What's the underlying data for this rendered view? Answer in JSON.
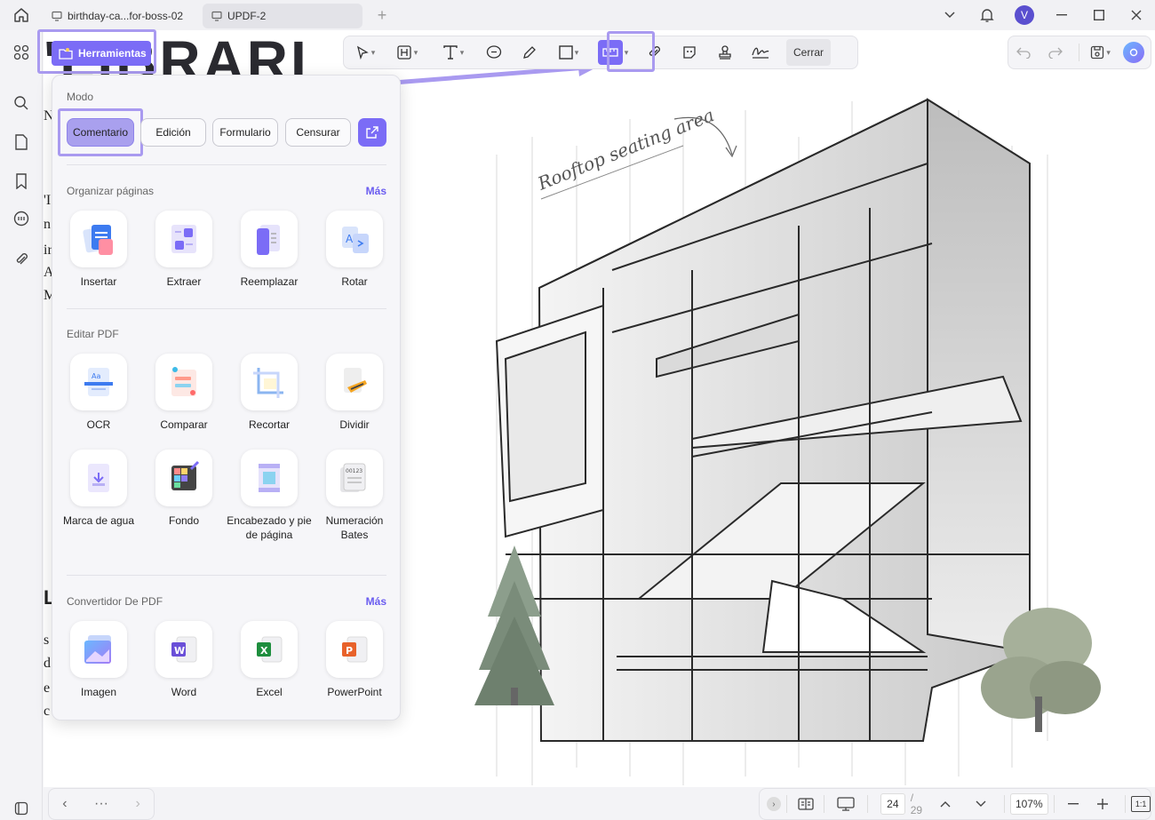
{
  "titlebar": {
    "tabs": [
      {
        "label": "birthday-ca...for-boss-02"
      },
      {
        "label": "UPDF-2"
      }
    ],
    "avatar_initial": "V"
  },
  "document": {
    "heading": "'LIBRARI",
    "snippets": [
      "Na",
      "'I",
      "n",
      "ir",
      "A",
      "M"
    ],
    "heading2": "L",
    "snippets2": [
      "s V",
      "d",
      "e",
      "c"
    ],
    "illustration_caption": "Rooftop seating area"
  },
  "ribbon": {
    "close_label": "Cerrar"
  },
  "tools_button": {
    "label": "Herramientas"
  },
  "panel": {
    "mode": {
      "title": "Modo",
      "buttons": [
        "Comentario",
        "Edición",
        "Formulario",
        "Censurar"
      ],
      "active": "Comentario"
    },
    "organize": {
      "title": "Organizar páginas",
      "more": "Más",
      "items": [
        "Insertar",
        "Extraer",
        "Reemplazar",
        "Rotar"
      ]
    },
    "edit": {
      "title": "Editar PDF",
      "items": [
        "OCR",
        "Comparar",
        "Recortar",
        "Dividir",
        "Marca de agua",
        "Fondo",
        "Encabezado y pie de página",
        "Numeración Bates"
      ]
    },
    "convert": {
      "title": "Convertidor De PDF",
      "more": "Más",
      "items": [
        "Imagen",
        "Word",
        "Excel",
        "PowerPoint"
      ]
    }
  },
  "bottombar": {
    "dots": "···",
    "page_current": "24",
    "page_total": "/ 29",
    "zoom": "107%"
  },
  "colors": {
    "accent": "#7b6cf6",
    "highlight": "#a99af0"
  }
}
